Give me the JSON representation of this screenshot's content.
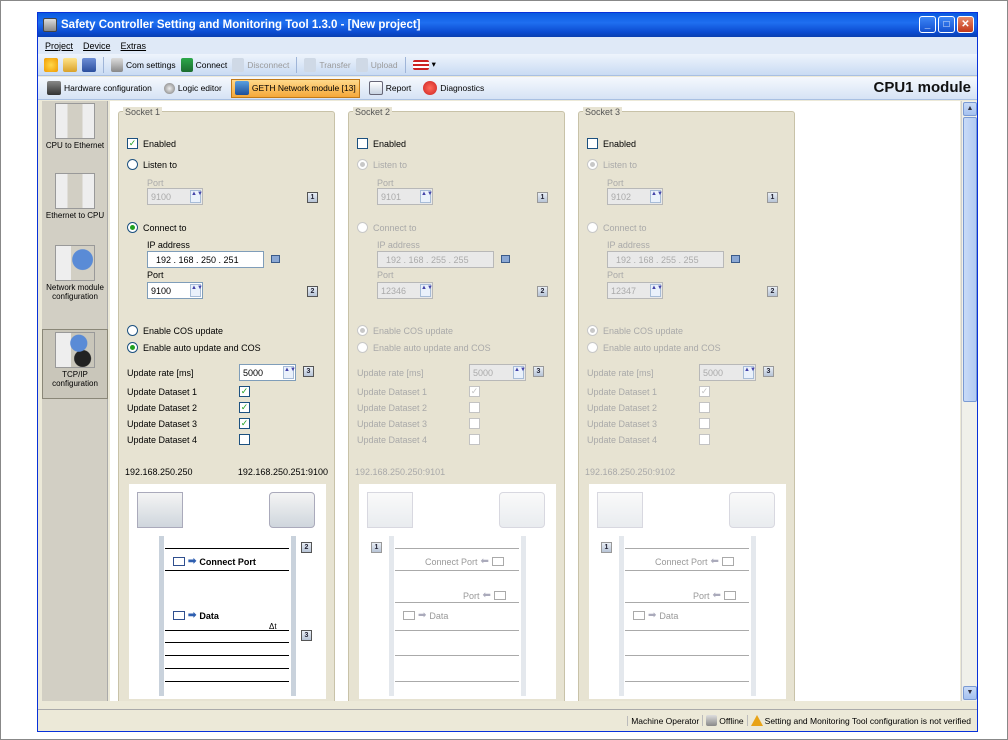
{
  "window": {
    "title": "Safety Controller Setting and Monitoring Tool 1.3.0 - [New project]"
  },
  "menu": [
    "Project",
    "Device",
    "Extras"
  ],
  "toolbar": {
    "com_settings": "Com settings",
    "connect": "Connect",
    "disconnect": "Disconnect",
    "transfer": "Transfer",
    "upload": "Upload"
  },
  "modebar": {
    "hardware": "Hardware configuration",
    "logic": "Logic editor",
    "geth": "GETH Network module [13]",
    "report": "Report",
    "diagnostics": "Diagnostics",
    "module": "CPU1 module"
  },
  "sidebar": [
    {
      "label": "CPU to Ethernet"
    },
    {
      "label": "Ethernet to CPU"
    },
    {
      "label": "Network module configuration"
    },
    {
      "label": "TCP/IP configuration"
    }
  ],
  "labels": {
    "enabled": "Enabled",
    "listen_to": "Listen to",
    "port": "Port",
    "connect_to": "Connect to",
    "ip_address": "IP address",
    "enable_cos": "Enable COS update",
    "enable_auto": "Enable auto update and COS",
    "update_rate": "Update rate [ms]",
    "dataset1": "Update Dataset 1",
    "dataset2": "Update Dataset 2",
    "dataset3": "Update Dataset 3",
    "dataset4": "Update Dataset 4",
    "connect_port": "Connect Port",
    "port_msg": "Port",
    "data_msg": "Data",
    "delta_t": "Δt"
  },
  "sockets": [
    {
      "title": "Socket 1",
      "listen_port": "9100",
      "ip": "192 . 168 . 250 . 251",
      "connect_port": "9100",
      "update_rate": "5000",
      "ip_left": "192.168.250.250",
      "ip_right": "192.168.250.251:9100"
    },
    {
      "title": "Socket 2",
      "listen_port": "9101",
      "ip": "192 . 168 . 255 . 255",
      "connect_port": "12346",
      "update_rate": "5000",
      "ip_left": "192.168.250.250:9101",
      "ip_right": ""
    },
    {
      "title": "Socket 3",
      "listen_port": "9102",
      "ip": "192 . 168 . 255 . 255",
      "connect_port": "12347",
      "update_rate": "5000",
      "ip_left": "192.168.250.250:9102",
      "ip_right": ""
    }
  ],
  "badges": {
    "one": "1",
    "two": "2",
    "three": "3"
  },
  "status": {
    "user": "Machine Operator",
    "conn": "Offline",
    "message": "Setting and Monitoring Tool configuration is not verified"
  }
}
